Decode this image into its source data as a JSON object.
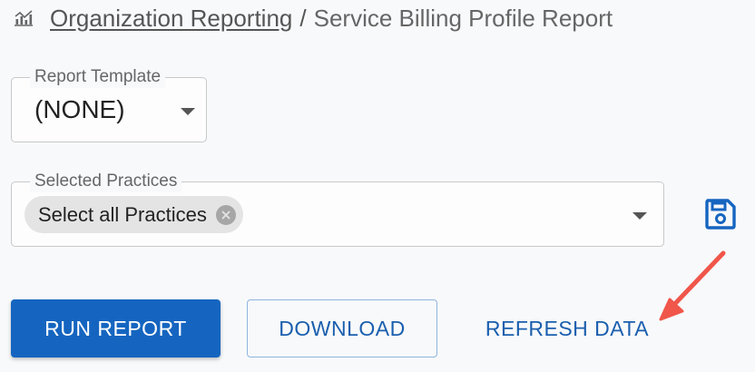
{
  "breadcrumb": {
    "icon": "analytics-chart-icon",
    "parent": "Organization Reporting",
    "separator": "/",
    "current": "Service Billing Profile Report"
  },
  "report_template": {
    "label": "Report Template",
    "value": "(NONE)"
  },
  "selected_practices": {
    "label": "Selected Practices",
    "chips": [
      "Select all Practices"
    ]
  },
  "save_button": {
    "icon": "save-floppy-icon"
  },
  "actions": {
    "run_report": "RUN REPORT",
    "download": "DOWNLOAD",
    "refresh_data": "REFRESH DATA"
  },
  "colors": {
    "primary": "#1565c0",
    "annotation_arrow": "#f0564a"
  }
}
